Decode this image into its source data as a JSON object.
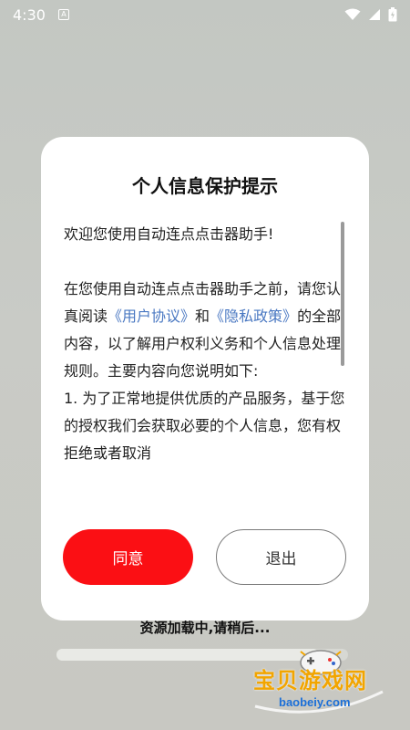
{
  "status_bar": {
    "time": "4:30",
    "app_icon": "A",
    "icons": [
      "wifi-icon",
      "signal-icon",
      "battery-icon"
    ]
  },
  "dialog": {
    "title": "个人信息保护提示",
    "welcome": "欢迎您使用自动连点点击器助手!",
    "para_before_link1": "在您使用自动连点点击器助手之前，请您认真阅读",
    "link_user_agreement": "《用户协议》",
    "para_and": "和",
    "link_privacy_policy": "《隐私政策》",
    "para_after_links": "的全部内容，以了解用户权利义务和个人信息处理规则。主要内容向您说明如下:",
    "item_1": "1. 为了正常地提供优质的产品服务，基于您的授权我们会获取必要的个人信息，您有权拒绝或者取消",
    "agree_label": "同意",
    "exit_label": "退出"
  },
  "loading": {
    "text": "资源加载中,请稍后...",
    "progress": 0.9
  },
  "watermark": {
    "title": "宝贝游戏网",
    "url": "baobeiy.com"
  },
  "colors": {
    "accent_red": "#fb0f14",
    "link_blue": "#4a78c2",
    "watermark_orange": "#f2a500",
    "watermark_blue": "#1b6fd8"
  }
}
